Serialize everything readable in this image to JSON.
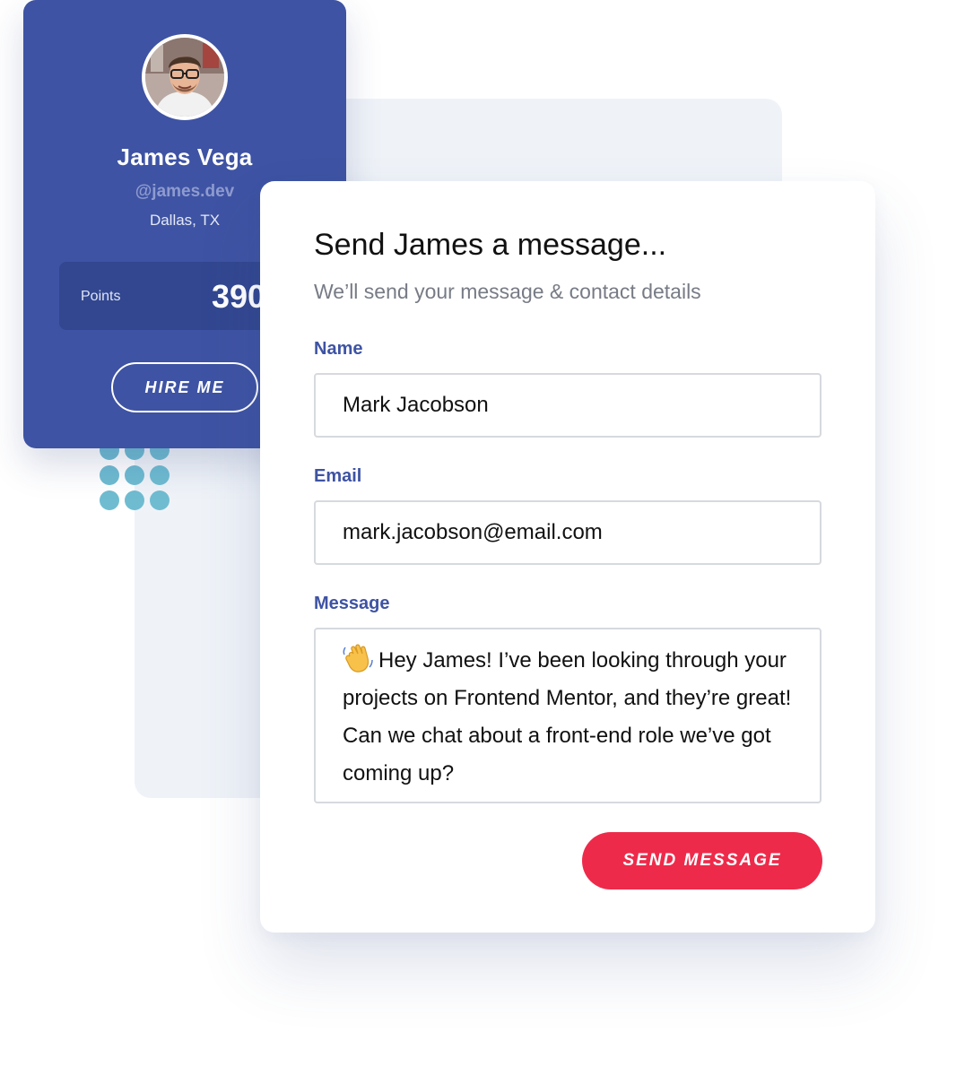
{
  "profile": {
    "name": "James Vega",
    "handle": "@james.dev",
    "location": "Dallas, TX",
    "points_label": "Points",
    "points_value": "390",
    "hire_label": "HIRE ME"
  },
  "message_form": {
    "title": "Send James a message...",
    "subtitle": "We’ll send your message & contact details",
    "fields": {
      "name": {
        "label": "Name",
        "value": "Mark Jacobson"
      },
      "email": {
        "label": "Email",
        "value": "mark.jacobson@email.com"
      },
      "message": {
        "label": "Message",
        "value": "Hey James! I’ve been looking through your projects on Frontend Mentor, and they’re great! Can we chat about a front-end role we’ve got coming up?"
      }
    },
    "send_label": "SEND MESSAGE"
  },
  "icons": {
    "avatar": "avatar-photo",
    "wave": "waving-hand-icon"
  },
  "colors": {
    "brand_blue": "#3e53a3",
    "accent_red": "#ee2a4a",
    "dots_teal": "#6fbcd1",
    "panel_bg": "#eff3f8"
  }
}
